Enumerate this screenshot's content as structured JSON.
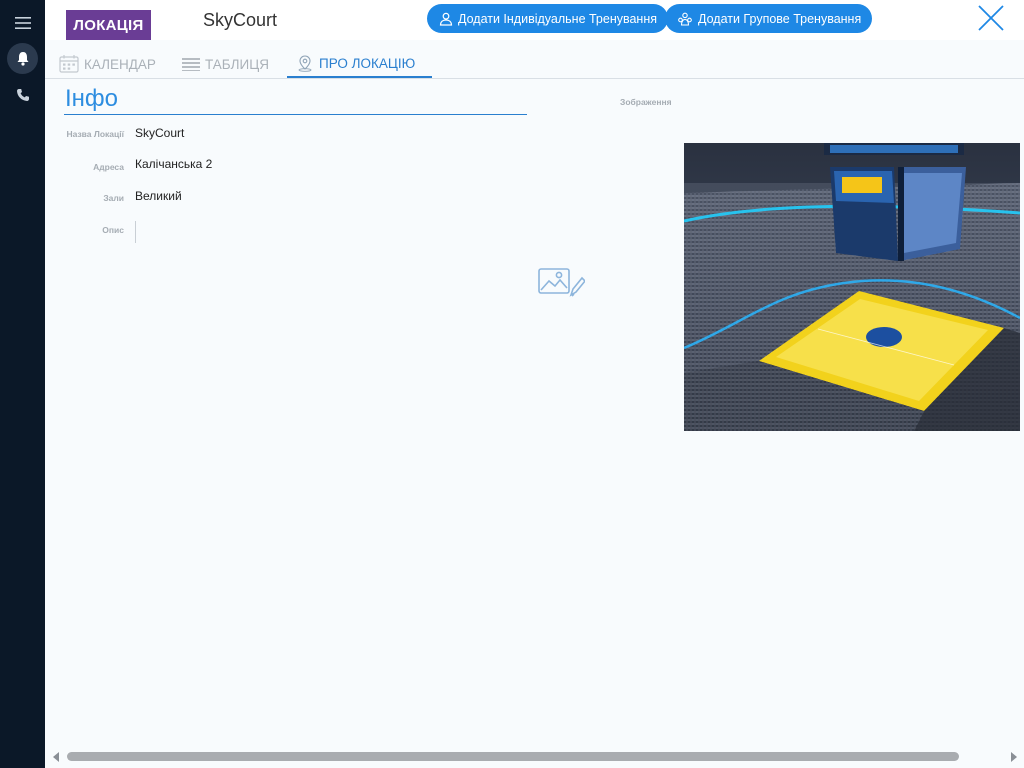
{
  "header": {
    "badge": "ЛОКАЦІЯ",
    "location_name": "SkyCourt",
    "add_individual_label": "Додати Індивідуальне Тренування",
    "add_group_label": "Додати Групове Тренування"
  },
  "tabs": [
    {
      "label": "КАЛЕНДАР",
      "icon": "calendar-icon",
      "active": false
    },
    {
      "label": "ТАБЛИЦЯ",
      "icon": "table-icon",
      "active": false
    },
    {
      "label": "ПРО ЛОКАЦІЮ",
      "icon": "location-pin-icon",
      "active": true
    }
  ],
  "info": {
    "title": "Інфо",
    "rows": [
      {
        "label": "Назва Локації",
        "value": "SkyCourt"
      },
      {
        "label": "Адреса",
        "value": "Калічанська 2"
      },
      {
        "label": "Зали",
        "value": "Великий"
      },
      {
        "label": "Опис",
        "value": ""
      }
    ]
  },
  "image_section": {
    "label": "Зображення"
  },
  "colors": {
    "rail": "#0b1828",
    "badge": "#6a3d95",
    "primary": "#1e88e5",
    "accent_text": "#2d8de0"
  }
}
